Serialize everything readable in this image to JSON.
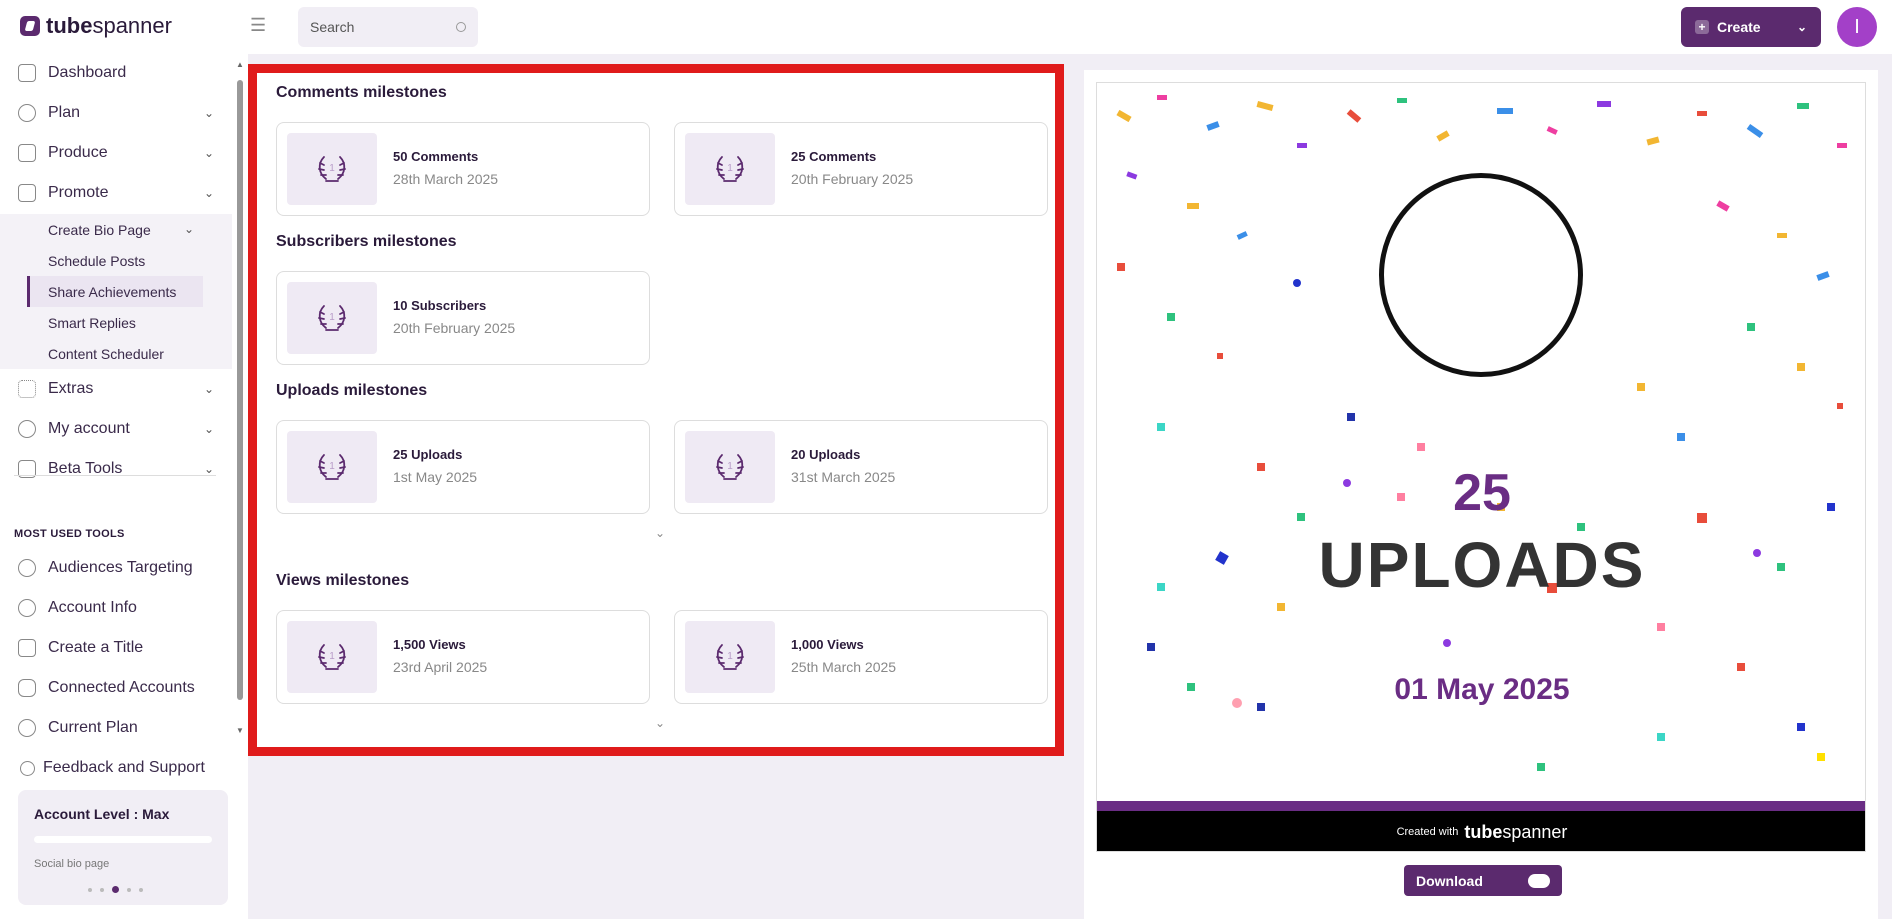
{
  "header": {
    "logo_bold": "tube",
    "logo_rest": "spanner",
    "search_placeholder": "Search",
    "create_label": "Create",
    "avatar_letter": "I"
  },
  "sidebar": {
    "items": [
      {
        "label": "Dashboard",
        "icon": "home-icon"
      },
      {
        "label": "Plan",
        "icon": "lightbulb-icon"
      },
      {
        "label": "Produce",
        "icon": "tools-icon"
      },
      {
        "label": "Promote",
        "icon": "megaphone-icon"
      }
    ],
    "promote_sub": [
      "Create Bio Page",
      "Schedule Posts",
      "Share Achievements",
      "Smart Replies",
      "Content Scheduler"
    ],
    "items2": [
      {
        "label": "Extras",
        "icon": "grid-icon"
      },
      {
        "label": "My account",
        "icon": "user-icon"
      },
      {
        "label": "Beta Tools",
        "icon": "tools-icon"
      }
    ],
    "most_used_heading": "MOST USED TOOLS",
    "tools": [
      {
        "label": "Audiences Targeting",
        "icon": "target-icon"
      },
      {
        "label": "Account Info",
        "icon": "user-icon"
      },
      {
        "label": "Create a Title",
        "icon": "heading-icon"
      },
      {
        "label": "Connected Accounts",
        "icon": "youtube-icon"
      },
      {
        "label": "Current Plan",
        "icon": "user-icon"
      },
      {
        "label": "Feedback and Support",
        "icon": "help-icon"
      }
    ],
    "account_card": {
      "level": "Account Level : Max",
      "sub": "Social bio page"
    }
  },
  "milestones": {
    "comments_title": "Comments milestones",
    "comments": [
      {
        "title": "50 Comments",
        "date": "28th March 2025"
      },
      {
        "title": "25 Comments",
        "date": "20th February 2025"
      }
    ],
    "subscribers_title": "Subscribers milestones",
    "subscribers": [
      {
        "title": "10 Subscribers",
        "date": "20th February 2025"
      }
    ],
    "uploads_title": "Uploads milestones",
    "uploads": [
      {
        "title": "25 Uploads",
        "date": "1st May 2025"
      },
      {
        "title": "20 Uploads",
        "date": "31st March 2025"
      }
    ],
    "views_title": "Views milestones",
    "views": [
      {
        "title": "1,500 Views",
        "date": "23rd April 2025"
      },
      {
        "title": "1,000 Views",
        "date": "25th March 2025"
      }
    ]
  },
  "preview": {
    "number": "25",
    "label": "UPLOADS",
    "date": "01 May 2025",
    "created_with": "Created with",
    "brand_bold": "tube",
    "brand_rest": "spanner"
  },
  "download_label": "Download",
  "colors": {
    "brand": "#5b2a6e",
    "accent": "#6a2d84",
    "highlight_border": "#e01b1b"
  }
}
